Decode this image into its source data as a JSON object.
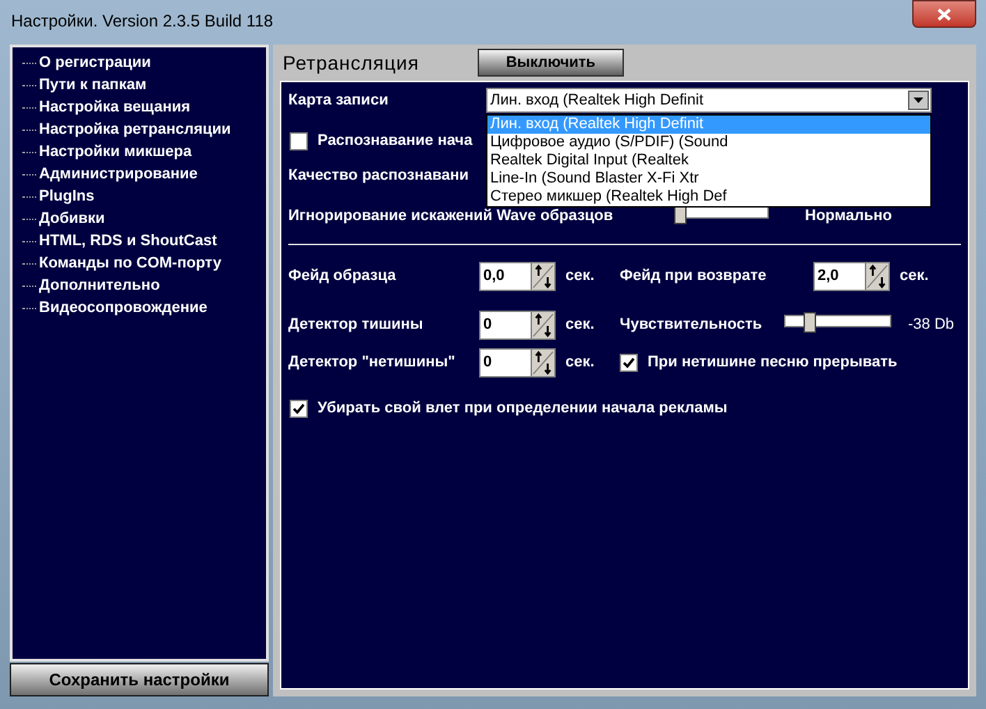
{
  "window": {
    "title": "Настройки. Version 2.3.5 Build 118"
  },
  "sidebar": {
    "items": [
      {
        "label": "О регистрации"
      },
      {
        "label": "Пути к папкам"
      },
      {
        "label": "Настройка вещания"
      },
      {
        "label": "Настройка ретрансляции"
      },
      {
        "label": "Настройки микшера"
      },
      {
        "label": "Администрирование"
      },
      {
        "label": "PlugIns"
      },
      {
        "label": "Добивки"
      },
      {
        "label": "HTML, RDS и ShoutCast"
      },
      {
        "label": "Команды по COM-порту"
      },
      {
        "label": "Дополнительно"
      },
      {
        "label": "Видеосопровождение"
      }
    ]
  },
  "save_button": "Сохранить настройки",
  "section": {
    "title": "Ретрансляция",
    "toggle_button": "Выключить"
  },
  "record_card": {
    "label": "Карта записи",
    "value": "Лин. вход (Realtek High Definit",
    "expanded": true,
    "options": [
      {
        "label": "Лин. вход (Realtek High Definit",
        "selected": true
      },
      {
        "label": "Цифровое аудио (S/PDIF) (Sound",
        "selected": false
      },
      {
        "label": "Realtek Digital Input (Realtek",
        "selected": false
      },
      {
        "label": "Line-In (Sound Blaster X-Fi Xtr",
        "selected": false
      },
      {
        "label": "Стерео микшер (Realtek High Def",
        "selected": false
      }
    ]
  },
  "detect_start": {
    "label": "Распознавание нача",
    "checked": false
  },
  "quality_label": "Качество распознавани",
  "wave_ignore": {
    "label": "Игнорирование искажений Wave образцов",
    "level": 0,
    "reading": "Нормально"
  },
  "fade_sample": {
    "label": "Фейд образца",
    "value": "0,0",
    "unit": "сек."
  },
  "fade_return": {
    "label": "Фейд при возврате",
    "value": "2,0",
    "unit": "сек."
  },
  "silence_detector": {
    "label": "Детектор тишины",
    "value": "0",
    "unit": "сек."
  },
  "sensitivity": {
    "label": "Чувствительность",
    "level": 0.2,
    "reading": "-38 Db"
  },
  "nonsilence_detector": {
    "label": "Детектор \"нетишины\"",
    "value": "0",
    "unit": "сек."
  },
  "interrupt_song": {
    "label": "При нетишине песню прерывать",
    "checked": true
  },
  "remove_jingle": {
    "label": "Убирать свой влет при определении начала рекламы",
    "checked": true
  }
}
